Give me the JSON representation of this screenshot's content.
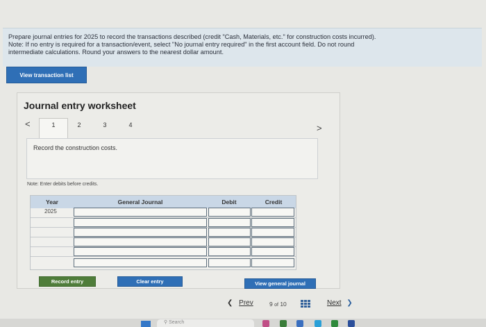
{
  "instructions": {
    "line1": "Prepare journal entries for 2025 to record the transactions described (credit \"Cash, Materials, etc.\" for construction costs incurred).",
    "line2": "Note: If no entry is required for a transaction/event, select \"No journal entry required\" in the first account field. Do not round",
    "line3": "intermediate calculations. Round your answers to the nearest dollar amount."
  },
  "view_transaction_list_label": "View transaction list",
  "worksheet": {
    "title": "Journal entry worksheet",
    "tabs": [
      "1",
      "2",
      "3",
      "4"
    ],
    "active_tab": "1",
    "prev_arrow": "<",
    "next_arrow": ">",
    "record_text": "Record the construction costs.",
    "note": "Note: Enter debits before credits.",
    "table": {
      "headers": {
        "year": "Year",
        "journal": "General Journal",
        "debit": "Debit",
        "credit": "Credit"
      },
      "year_value": "2025"
    },
    "record_entry_label": "Record entry",
    "clear_entry_label": "Clear entry",
    "view_general_journal_label": "View general journal"
  },
  "pager": {
    "prev_label": "Prev",
    "current": "9",
    "of_label": "of",
    "total": "10",
    "next_label": "Next"
  },
  "taskbar": {
    "search_placeholder": "Search"
  },
  "colors": {
    "instruction_bg": "#dde6ec",
    "button_blue": "#2f6fb6",
    "button_green": "#4f7d3a",
    "table_header": "#c9d7e6"
  }
}
